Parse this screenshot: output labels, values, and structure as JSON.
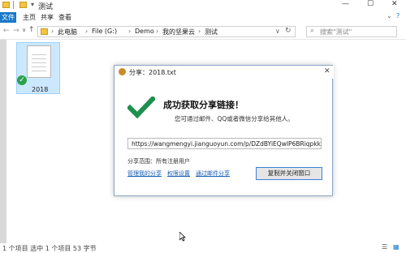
{
  "window": {
    "title": "测试",
    "minimize": "—",
    "maximize": "☐",
    "close": "✕"
  },
  "menu": [
    "文件",
    "主页",
    "共享",
    "查看"
  ],
  "address": {
    "crumbs": [
      "此电脑",
      "File (G:)",
      "Demo",
      "我的坚果云",
      "测试"
    ],
    "search_placeholder": "搜索\"测试\""
  },
  "file": {
    "name": "2018"
  },
  "status": {
    "text": "1 个项目   选中 1 个项目  53 字节"
  },
  "dialog": {
    "title": "分享：2018.txt",
    "close": "✕",
    "success_heading": "成功获取分享链接！",
    "subtitle": "您可通过邮件、QQ或者微信分享给其他人。",
    "link": "https://wangmengyi.jianguoyun.com/p/DZdBYiEQwIP6BRiqpkk",
    "scope": "分享范围：所有注册用户",
    "links": [
      "管理我的分享",
      "权限设置",
      "通过邮件分享"
    ],
    "copy_button": "复制并关闭窗口"
  },
  "colors": {
    "check_green": "#1e8f4f",
    "link_blue": "#1a5fb4",
    "selection_blue": "#cce8ff"
  }
}
